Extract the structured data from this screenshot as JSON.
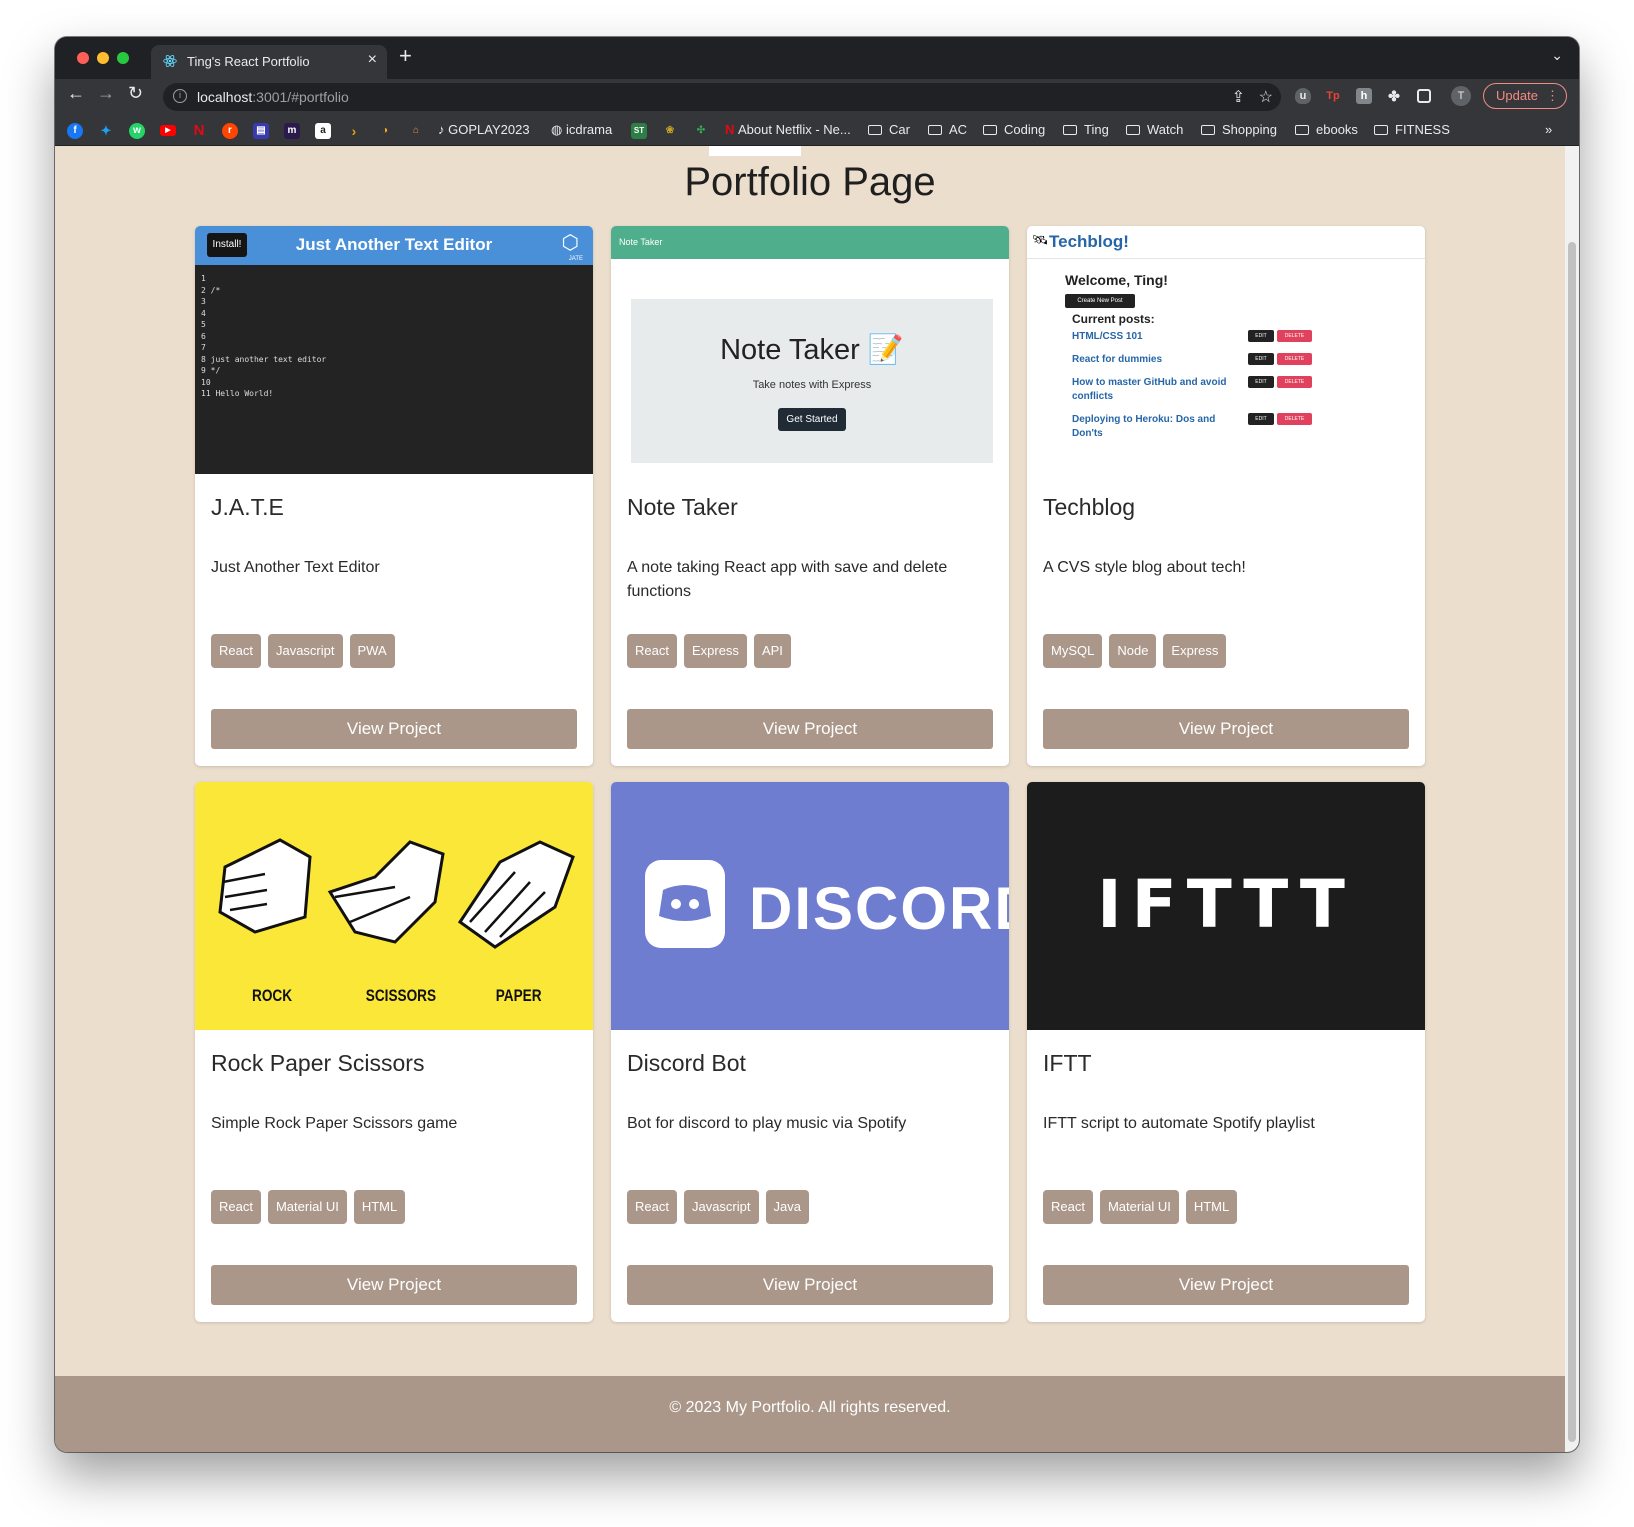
{
  "browser": {
    "tab_title": "Ting's React Portfolio",
    "tab_close": "×",
    "new_tab": "+",
    "url_host": "localhost",
    "url_path": ":3001/#portfolio",
    "update_label": "Update",
    "profile_initial": "T",
    "bookmarks": [
      "GOPLAY2023",
      "icdrama",
      "About Netflix - Ne...",
      "Car",
      "AC",
      "Coding",
      "Ting",
      "Watch",
      "Shopping",
      "ebooks",
      "FITNESS"
    ],
    "more_bookmarks": "»"
  },
  "page": {
    "title": "Portfolio Page",
    "footer": "© 2023 My Portfolio. All rights reserved.",
    "view_label": "View Project"
  },
  "projects": [
    {
      "title": "J.A.T.E",
      "description": "Just Another Text Editor",
      "tags": [
        "React",
        "Javascript",
        "PWA"
      ]
    },
    {
      "title": "Note Taker",
      "description": "A note taking React app with save and delete functions",
      "tags": [
        "React",
        "Express",
        "API"
      ]
    },
    {
      "title": "Techblog",
      "description": "A CVS style blog about tech!",
      "tags": [
        "MySQL",
        "Node",
        "Express"
      ]
    },
    {
      "title": "Rock Paper Scissors",
      "description": "Simple Rock Paper Scissors game",
      "tags": [
        "React",
        "Material UI",
        "HTML"
      ]
    },
    {
      "title": "Discord Bot",
      "description": "Bot for discord to play music via Spotify",
      "tags": [
        "React",
        "Javascript",
        "Java"
      ]
    },
    {
      "title": "IFTT",
      "description": "IFTT script to automate Spotify playlist",
      "tags": [
        "React",
        "Material UI",
        "HTML"
      ]
    }
  ],
  "thumbs": {
    "jate": {
      "install": "Install!",
      "title": "Just Another Text Editor",
      "logo_caption": "JATE",
      "code": [
        "1",
        "2 /*",
        "3",
        "4",
        "5",
        "6",
        "7",
        "8 just another text editor",
        "9 */",
        "10",
        "11 Hello World!"
      ]
    },
    "notetaker": {
      "bar": "Note Taker",
      "heading": "Note Taker 📝",
      "sub": "Take notes with Express",
      "button": "Get Started"
    },
    "techblog": {
      "brand": "Techblog!",
      "welcome": "Welcome, Ting!",
      "new_post": "Create New Post",
      "current": "Current posts:",
      "edit": "EDIT",
      "delete": "DELETE",
      "posts": [
        "HTML/CSS 101",
        "React for dummies",
        "How to master GitHub and avoid conflicts",
        "Deploying to Heroku: Dos and Don'ts"
      ]
    },
    "rps": {
      "labels": [
        "ROCK",
        "SCISSORS",
        "PAPER"
      ]
    },
    "discord": {
      "word": "DISCORD"
    },
    "ifttt": {
      "word": "IFTTT"
    }
  },
  "colors": {
    "page_bg": "#ecdecc",
    "accent": "#ab978a",
    "card_bg": "#ffffff"
  }
}
